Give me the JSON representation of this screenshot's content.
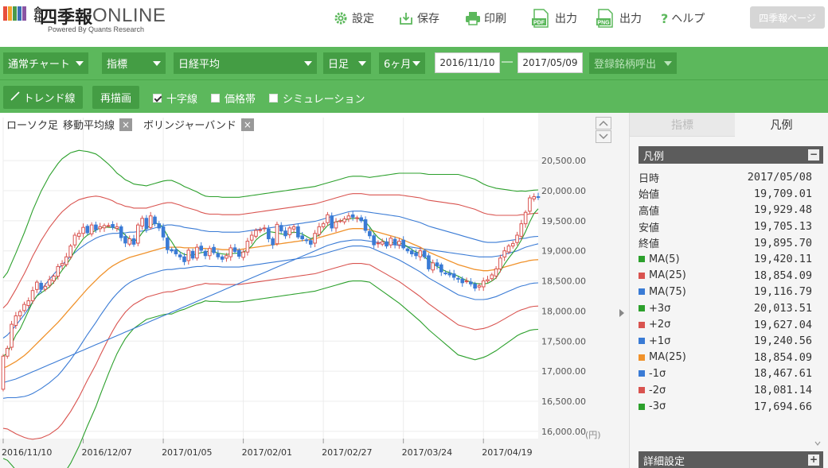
{
  "header": {
    "logo_kanji": "四季報",
    "logo_prefix": "会社",
    "logo_online": "ONLINE",
    "logo_sub": "Powered By Quants Research",
    "settings_label": "設定",
    "save_label": "保存",
    "print_label": "印刷",
    "pdf_label": "出力",
    "png_label": "出力",
    "help_label": "ヘルプ",
    "shikiho_page_label": "四季報ページ",
    "pdf_icon_text": "PDF",
    "png_icon_text": "PNG"
  },
  "toolbar1": {
    "chart_type": "通常チャート",
    "index_type": "指標",
    "index_name": "日経平均",
    "period_unit": "日足",
    "range": "6ヶ月",
    "date_from": "2016/11/10",
    "date_sep": "―",
    "date_to": "2017/05/09",
    "saved_stock": "登録銘柄呼出"
  },
  "toolbar2": {
    "trend_label": "トレンド線",
    "redraw_label": "再描画",
    "crosshair_label": "十字線",
    "crosshair_checked": true,
    "price_band_label": "価格帯",
    "price_band_checked": false,
    "simulation_label": "シミュレーション",
    "simulation_checked": false
  },
  "chart": {
    "tag_candle": "ローソク足",
    "tag_ma": "移動平均線",
    "tag_bb": "ボリンジャーバンド",
    "tag_close": "×",
    "unit_label": "(円)"
  },
  "right_panel": {
    "tab_indicators": "指標",
    "tab_legend": "凡例",
    "legend_title": "凡例",
    "legend_toggle": "−",
    "detail_title": "詳細設定",
    "detail_toggle": "+",
    "rows": [
      {
        "label": "日時",
        "value": "2017/05/08",
        "color": ""
      },
      {
        "label": "始値",
        "value": "19,709.01",
        "color": ""
      },
      {
        "label": "高値",
        "value": "19,929.48",
        "color": ""
      },
      {
        "label": "安値",
        "value": "19,705.13",
        "color": ""
      },
      {
        "label": "終値",
        "value": "19,895.70",
        "color": ""
      },
      {
        "label": "MA(5)",
        "value": "19,420.11",
        "color": "#2ca02c"
      },
      {
        "label": "MA(25)",
        "value": "18,854.09",
        "color": "#d9534f"
      },
      {
        "label": "MA(75)",
        "value": "19,116.79",
        "color": "#3a7bd5"
      },
      {
        "label": "+3σ",
        "value": "20,013.51",
        "color": "#2ca02c"
      },
      {
        "label": "+2σ",
        "value": "19,627.04",
        "color": "#d9534f"
      },
      {
        "label": "+1σ",
        "value": "19,240.56",
        "color": "#3a7bd5"
      },
      {
        "label": "MA(25)",
        "value": "18,854.09",
        "color": "#f0922b"
      },
      {
        "label": "-1σ",
        "value": "18,467.61",
        "color": "#3a7bd5"
      },
      {
        "label": "-2σ",
        "value": "18,081.14",
        "color": "#d9534f"
      },
      {
        "label": "-3σ",
        "value": "17,694.66",
        "color": "#2ca02c"
      }
    ]
  },
  "chart_data": {
    "type": "line",
    "y_ticks": [
      20500,
      20000,
      19500,
      19000,
      18500,
      18000,
      17500,
      17000,
      16500,
      16000
    ],
    "y_tick_labels": [
      "20,500.00",
      "20,000.00",
      "19,500.00",
      "19,000.00",
      "18,500.00",
      "18,000.00",
      "17,500.00",
      "17,000.00",
      "16,500.00",
      "16,000.00"
    ],
    "ylim": [
      15880,
      20950
    ],
    "x_labels": [
      "2016/11/10",
      "2016/12/07",
      "2017/01/05",
      "2017/02/01",
      "2017/02/27",
      "2017/03/24",
      "2017/04/19"
    ],
    "x_label_index": [
      0,
      19,
      38,
      57,
      76,
      95,
      114
    ],
    "grid": true,
    "colors": {
      "up": "#d9534f",
      "down": "#3a7bd5",
      "ma5": "#2ca02c",
      "ma25": "#f0922b",
      "ma75": "#3a7bd5",
      "sigma3": "#2ca02c",
      "sigma2": "#d9534f",
      "sigma1": "#3a7bd5"
    },
    "close": [
      17250,
      17380,
      17780,
      17920,
      17990,
      18110,
      18170,
      18340,
      18480,
      18360,
      18410,
      18520,
      18580,
      18740,
      18790,
      18900,
      19080,
      19260,
      19290,
      19390,
      19300,
      19430,
      19350,
      19400,
      19420,
      19420,
      19390,
      19400,
      19220,
      19130,
      19200,
      19110,
      19430,
      19540,
      19370,
      19580,
      19450,
      19380,
      19230,
      19020,
      19000,
      18950,
      18900,
      18820,
      19010,
      18880,
      19060,
      19010,
      18920,
      19040,
      18970,
      18900,
      18860,
      18920,
      19050,
      18990,
      18910,
      18980,
      19160,
      19260,
      19340,
      19350,
      19380,
      19200,
      19100,
      19440,
      19330,
      19250,
      19380,
      19400,
      19230,
      19200,
      19170,
      19110,
      19290,
      19400,
      19450,
      19600,
      19380,
      19480,
      19500,
      19530,
      19580,
      19560,
      19550,
      19500,
      19340,
      19250,
      19100,
      19130,
      19150,
      19080,
      19210,
      19100,
      19160,
      19050,
      19000,
      18950,
      18920,
      19000,
      18900,
      18700,
      18800,
      18750,
      18650,
      18630,
      18600,
      18560,
      18530,
      18470,
      18500,
      18450,
      18380,
      18420,
      18500,
      18520,
      18600,
      18700,
      18880,
      19000,
      19080,
      19120,
      19260,
      19450,
      19640,
      19880,
      19900,
      19896
    ],
    "ma5": [
      17250,
      17300,
      17450,
      17600,
      17700,
      17850,
      18000,
      18150,
      18250,
      18300,
      18350,
      18400,
      18480,
      18580,
      18680,
      18770,
      18870,
      19000,
      19100,
      19200,
      19260,
      19300,
      19340,
      19380,
      19400,
      19390,
      19390,
      19370,
      19330,
      19260,
      19200,
      19150,
      19200,
      19300,
      19380,
      19420,
      19460,
      19450,
      19380,
      19250,
      19150,
      19040,
      18980,
      18940,
      18930,
      18930,
      18950,
      18970,
      18980,
      19000,
      18990,
      18960,
      18950,
      18940,
      18950,
      18960,
      18960,
      18980,
      19020,
      19080,
      19180,
      19240,
      19280,
      19320,
      19310,
      19300,
      19280,
      19270,
      19290,
      19310,
      19300,
      19280,
      19240,
      19200,
      19230,
      19260,
      19340,
      19420,
      19460,
      19480,
      19500,
      19510,
      19530,
      19540,
      19540,
      19520,
      19480,
      19400,
      19300,
      19220,
      19170,
      19140,
      19140,
      19130,
      19130,
      19110,
      19070,
      19020,
      18980,
      18960,
      18900,
      18840,
      18790,
      18740,
      18700,
      18660,
      18640,
      18610,
      18580,
      18540,
      18510,
      18480,
      18460,
      18450,
      18450,
      18460,
      18500,
      18550,
      18660,
      18780,
      18880,
      18970,
      19060,
      19180,
      19320,
      19480,
      19620,
      19700
    ],
    "ma25": [
      17050,
      17080,
      17120,
      17160,
      17210,
      17260,
      17320,
      17390,
      17460,
      17530,
      17600,
      17670,
      17740,
      17810,
      17890,
      17970,
      18050,
      18130,
      18210,
      18290,
      18370,
      18440,
      18510,
      18580,
      18640,
      18700,
      18750,
      18790,
      18830,
      18860,
      18890,
      18910,
      18930,
      18950,
      18970,
      18990,
      19010,
      19030,
      19050,
      19060,
      19060,
      19060,
      19060,
      19050,
      19050,
      19050,
      19050,
      19040,
      19040,
      19030,
      19030,
      19030,
      19020,
      19020,
      19020,
      19020,
      19020,
      19030,
      19040,
      19050,
      19060,
      19070,
      19080,
      19090,
      19100,
      19110,
      19120,
      19130,
      19140,
      19150,
      19160,
      19170,
      19180,
      19190,
      19200,
      19220,
      19240,
      19260,
      19280,
      19300,
      19320,
      19340,
      19360,
      19370,
      19370,
      19370,
      19360,
      19350,
      19330,
      19310,
      19290,
      19270,
      19250,
      19230,
      19210,
      19180,
      19150,
      19120,
      19090,
      19060,
      19020,
      18980,
      18950,
      18920,
      18890,
      18860,
      18830,
      18800,
      18770,
      18750,
      18730,
      18710,
      18690,
      18680,
      18670,
      18670,
      18680,
      18690,
      18710,
      18730,
      18750,
      18770,
      18790,
      18810,
      18820,
      18840,
      18850,
      18854
    ],
    "ma75": [
      16810,
      16830,
      16850,
      16870,
      16900,
      16930,
      16960,
      16990,
      17020,
      17050,
      17080,
      17110,
      17140,
      17170,
      17200,
      17230,
      17260,
      17290,
      17320,
      17350,
      17380,
      17410,
      17440,
      17470,
      17500,
      17530,
      17560,
      17590,
      17620,
      17650,
      17680,
      17710,
      17740,
      17770,
      17800,
      17830,
      17860,
      17890,
      17920,
      17950,
      17980,
      18010,
      18040,
      18070,
      18100,
      18130,
      18160,
      18190,
      18220,
      18250,
      18280,
      18310,
      18340,
      18370,
      18400,
      18430,
      18460,
      18490,
      18520,
      18550,
      18580,
      18610,
      18640,
      18670,
      18700,
      18730,
      18760,
      18790,
      18820,
      18850,
      18880,
      18910,
      18940,
      18970,
      19000,
      19030,
      19060,
      19090,
      19110,
      19130,
      19150,
      19160,
      19170,
      19180,
      19180,
      19180,
      19170,
      19160,
      19150,
      19140,
      19130,
      19120,
      19110,
      19100,
      19090,
      19080,
      19070,
      19060,
      19050,
      19040,
      19030,
      19020,
      19010,
      19000,
      18990,
      18980,
      18970,
      18960,
      18950,
      18940,
      18930,
      18920,
      18910,
      18900,
      18900,
      18900,
      18900,
      18910,
      18920,
      18940,
      18960,
      18980,
      19000,
      19030,
      19060,
      19080,
      19100,
      19117
    ],
    "sigma": [
      500,
      520,
      560,
      600,
      640,
      680,
      720,
      760,
      790,
      820,
      840,
      860,
      870,
      880,
      880,
      870,
      860,
      840,
      820,
      790,
      760,
      730,
      700,
      660,
      620,
      580,
      540,
      500,
      470,
      440,
      420,
      400,
      390,
      380,
      370,
      370,
      370,
      370,
      370,
      370,
      370,
      360,
      350,
      340,
      330,
      320,
      310,
      300,
      290,
      290,
      290,
      290,
      290,
      290,
      290,
      290,
      290,
      290,
      290,
      290,
      290,
      290,
      290,
      290,
      290,
      290,
      290,
      290,
      290,
      290,
      290,
      290,
      290,
      290,
      290,
      290,
      290,
      290,
      290,
      290,
      290,
      290,
      290,
      290,
      290,
      290,
      290,
      290,
      300,
      310,
      320,
      330,
      340,
      350,
      360,
      370,
      380,
      390,
      400,
      410,
      420,
      430,
      440,
      450,
      460,
      470,
      480,
      490,
      500,
      500,
      500,
      500,
      500,
      490,
      480,
      470,
      460,
      450,
      440,
      430,
      420,
      410,
      400,
      395,
      390,
      387,
      386,
      386
    ]
  }
}
